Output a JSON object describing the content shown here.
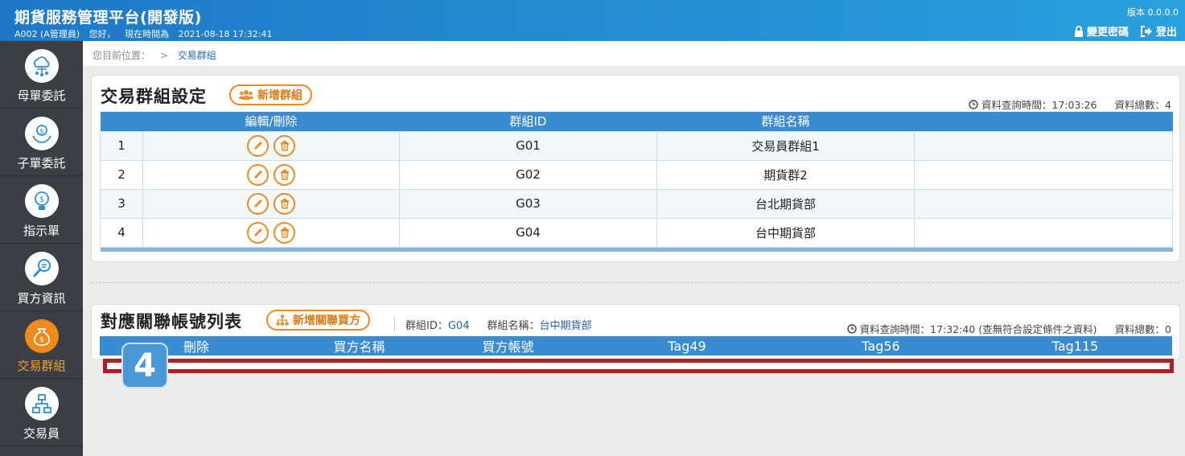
{
  "header": {
    "title": "期貨服務管理平台(開發版)",
    "user": "A002 (A管理員)",
    "greeting": "您好，",
    "time_label": "現在時間為",
    "time": "2021-08-18 17:32:41",
    "version": "版本 0.0.0.0",
    "change_password": "變更密碼",
    "logout": "登出"
  },
  "sidebar": {
    "items": [
      {
        "label": "母單委託",
        "icon": "cloud-network-icon"
      },
      {
        "label": "子單委託",
        "icon": "hand-dollar-icon"
      },
      {
        "label": "指示單",
        "icon": "bulb-dollar-icon"
      },
      {
        "label": "買方資訊",
        "icon": "magnifier-icon"
      },
      {
        "label": "交易群組",
        "icon": "money-bag-icon",
        "active": true
      },
      {
        "label": "交易員",
        "icon": "org-chart-icon"
      }
    ]
  },
  "breadcrumb": {
    "prefix": "您目前位置：",
    "sep": ">",
    "current": "交易群組"
  },
  "group_panel": {
    "title": "交易群組設定",
    "add_button": "新增群組",
    "query_time": "資料查詢時間：17:03:26",
    "total": "資料總數：4",
    "columns": [
      "",
      "編輯/刪除",
      "群組ID",
      "群組名稱",
      ""
    ],
    "rows": [
      {
        "no": "1",
        "id": "G01",
        "name": "交易員群組1"
      },
      {
        "no": "2",
        "id": "G02",
        "name": "期貨群2"
      },
      {
        "no": "3",
        "id": "G03",
        "name": "台北期貨部"
      },
      {
        "no": "4",
        "id": "G04",
        "name": "台中期貨部"
      }
    ]
  },
  "account_panel": {
    "title": "對應關聯帳號列表",
    "add_button": "新增關聯買方",
    "group_id_label": "群組ID：",
    "group_id": "G04",
    "group_name_label": "群組名稱：",
    "group_name": "台中期貨部",
    "query_time": "資料查詢時間：17:32:40 (查無符合設定條件之資料)",
    "total": "資料總數：0",
    "columns": [
      "刪除",
      "買方名稱",
      "買方帳號",
      "Tag49",
      "Tag56",
      "Tag115"
    ]
  },
  "annotation": {
    "badge": "4",
    "highlight_color": "#b01e22",
    "badge_color": "#4a98d6"
  },
  "colors": {
    "header_start": "#1e78c9",
    "header_end": "#2aa0de",
    "accent": "#f08a1c",
    "table_header": "#3a8bd1",
    "sidebar": "#3b3f45"
  }
}
